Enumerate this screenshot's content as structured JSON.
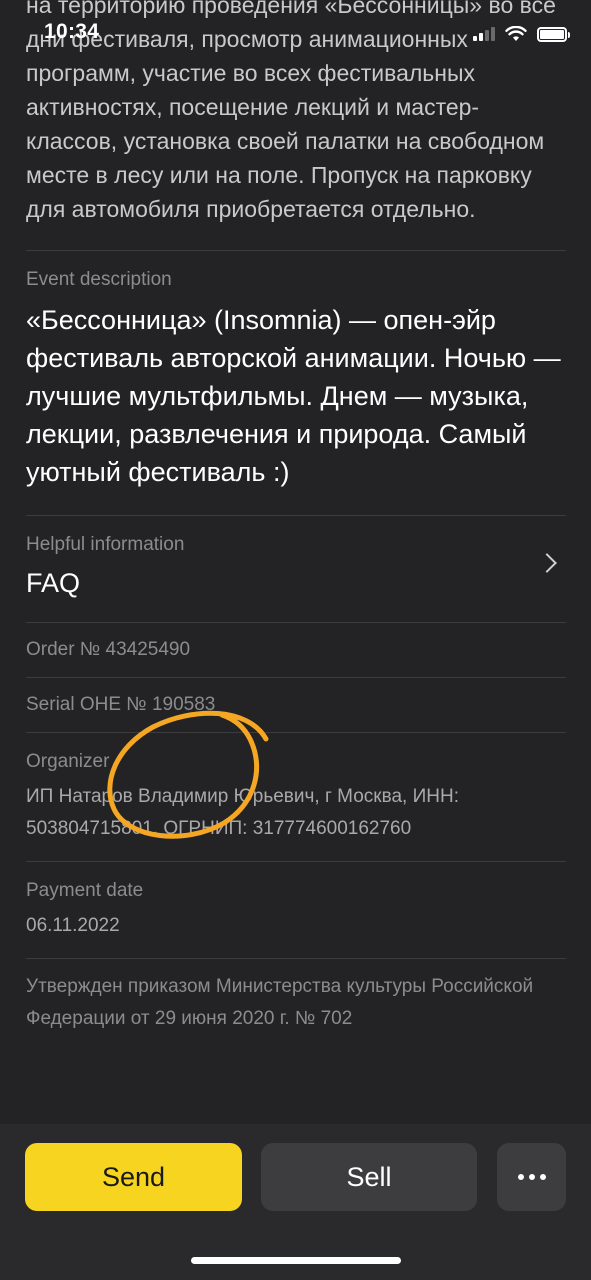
{
  "status_bar": {
    "time": "10:34"
  },
  "intro": {
    "text": "на территорию проведения «Бессонницы» во все дни фестиваля, просмотр анимационных программ, участие во всех фестивальных активностях, посещение лекций и мастер-классов, установка своей палатки на свободном месте в лесу или на поле. Пропуск на парковку для автомобиля приобретается отдельно."
  },
  "event_description": {
    "label": "Event description",
    "text": "«Бессонница» (Insomnia) — опен-эйр фестиваль авторской анимации. Ночью — лучшие мультфильмы. Днем — музыка, лекции, развлечения и природа. Самый уютный фестиваль :)"
  },
  "helpful_info": {
    "label": "Helpful information",
    "link": "FAQ"
  },
  "order": {
    "text": "Order № 43425490"
  },
  "serial": {
    "text": "Serial ОНЕ № 190583"
  },
  "organizer": {
    "label": "Organizer",
    "text": "ИП Натаров Владимир Юрьевич, г Москва, ИНН: 503804715801, ОГРНИП: 317774600162760"
  },
  "payment": {
    "label": "Payment date",
    "date": "06.11.2022"
  },
  "approval": {
    "text": "Утвержден приказом Министерства культуры Российской Федерации от 29 июня 2020 г. № 702"
  },
  "actions": {
    "send": "Send",
    "sell": "Sell",
    "more_icon": "ellipsis-icon"
  },
  "colors": {
    "accent": "#f6d420",
    "background": "#232325",
    "annotation": "#f5a623"
  }
}
